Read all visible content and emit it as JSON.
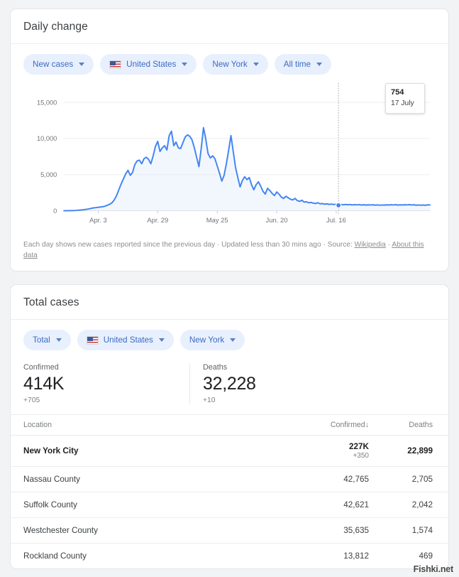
{
  "daily_card": {
    "title": "Daily change",
    "chips": [
      {
        "label": "New cases",
        "icon": "chevron-down-icon",
        "flag": false
      },
      {
        "label": "United States",
        "icon": "chevron-down-icon",
        "flag": true
      },
      {
        "label": "New York",
        "icon": "chevron-down-icon",
        "flag": false
      },
      {
        "label": "All time",
        "icon": "chevron-down-icon",
        "flag": false
      }
    ],
    "tooltip": {
      "value": "754",
      "date": "17 July"
    },
    "note_main": "Each day shows new cases reported since the previous day · Updated less than 30 mins ago  ·  Source: ",
    "note_source": "Wikipedia",
    "note_sep": " · ",
    "note_about": "About this data"
  },
  "chart_data": {
    "type": "line",
    "title": "Daily change",
    "xlabel": "",
    "ylabel": "",
    "ylim": [
      0,
      16500
    ],
    "grid": true,
    "legend": "none",
    "yticks": [
      0,
      5000,
      10000,
      15000
    ],
    "ytick_labels": [
      "0",
      "5,000",
      "10,000",
      "15,000"
    ],
    "xtick_labels": [
      "Apr. 3",
      "Apr. 29",
      "May 25",
      "Jun. 20",
      "Jul. 16"
    ],
    "xtick_indices": [
      15,
      41,
      67,
      93,
      119
    ],
    "series_name": "New cases",
    "line_color": "#4285f4",
    "fill_color": "#e8f0fe",
    "marker": {
      "index": 120,
      "value": 754,
      "label": "754",
      "date": "17 July"
    },
    "values": [
      0,
      5,
      10,
      15,
      20,
      35,
      60,
      90,
      120,
      160,
      200,
      260,
      330,
      400,
      430,
      470,
      520,
      560,
      640,
      760,
      900,
      1100,
      1500,
      2100,
      2900,
      3700,
      4400,
      5100,
      5600,
      4900,
      5300,
      6400,
      6900,
      7000,
      6500,
      7200,
      7400,
      7100,
      6500,
      7600,
      8900,
      9600,
      8200,
      8700,
      9000,
      8400,
      10400,
      11000,
      9000,
      9500,
      8700,
      8600,
      9400,
      10200,
      10500,
      10300,
      9800,
      8700,
      7400,
      6100,
      8600,
      11500,
      9900,
      7900,
      7300,
      7600,
      7200,
      6200,
      5200,
      4100,
      4900,
      6500,
      8400,
      10400,
      8200,
      6000,
      4600,
      3300,
      4200,
      4700,
      4300,
      4600,
      3600,
      2900,
      3600,
      4000,
      3400,
      2700,
      2300,
      3100,
      2800,
      2400,
      2100,
      2600,
      2300,
      1900,
      1700,
      2000,
      1800,
      1600,
      1500,
      1700,
      1400,
      1300,
      1450,
      1200,
      1250,
      1100,
      1150,
      1050,
      1000,
      1100,
      950,
      1000,
      900,
      950,
      880,
      920,
      860,
      900,
      850,
      880,
      820,
      870,
      830,
      860,
      800,
      840,
      810,
      850,
      790,
      830,
      780,
      820,
      800,
      830,
      770,
      810,
      760,
      800,
      780,
      820,
      790,
      830,
      800,
      840,
      780,
      820,
      790,
      830,
      810,
      840,
      800,
      830,
      770,
      800,
      760,
      790,
      754,
      820,
      800
    ]
  },
  "total_card": {
    "title": "Total cases",
    "chips": [
      {
        "label": "Total",
        "icon": "chevron-down-icon",
        "flag": false
      },
      {
        "label": "United States",
        "icon": "chevron-down-icon",
        "flag": true
      },
      {
        "label": "New York",
        "icon": "chevron-down-icon",
        "flag": false
      }
    ],
    "summary": [
      {
        "label": "Confirmed",
        "value": "414K",
        "delta": "+705"
      },
      {
        "label": "Deaths",
        "value": "32,228",
        "delta": "+10"
      }
    ],
    "table": {
      "columns": [
        "Location",
        "Confirmed",
        "Deaths"
      ],
      "sort_indicator": "↓",
      "rows": [
        {
          "location": "New York City",
          "confirmed": "227K",
          "confirmed_delta": "+350",
          "deaths": "22,899",
          "highlight": true
        },
        {
          "location": "Nassau County",
          "confirmed": "42,765",
          "confirmed_delta": "",
          "deaths": "2,705",
          "highlight": false
        },
        {
          "location": "Suffolk County",
          "confirmed": "42,621",
          "confirmed_delta": "",
          "deaths": "2,042",
          "highlight": false
        },
        {
          "location": "Westchester County",
          "confirmed": "35,635",
          "confirmed_delta": "",
          "deaths": "1,574",
          "highlight": false
        },
        {
          "location": "Rockland County",
          "confirmed": "13,812",
          "confirmed_delta": "",
          "deaths": "469",
          "highlight": false
        }
      ]
    }
  },
  "watermark": "Fishki.net"
}
